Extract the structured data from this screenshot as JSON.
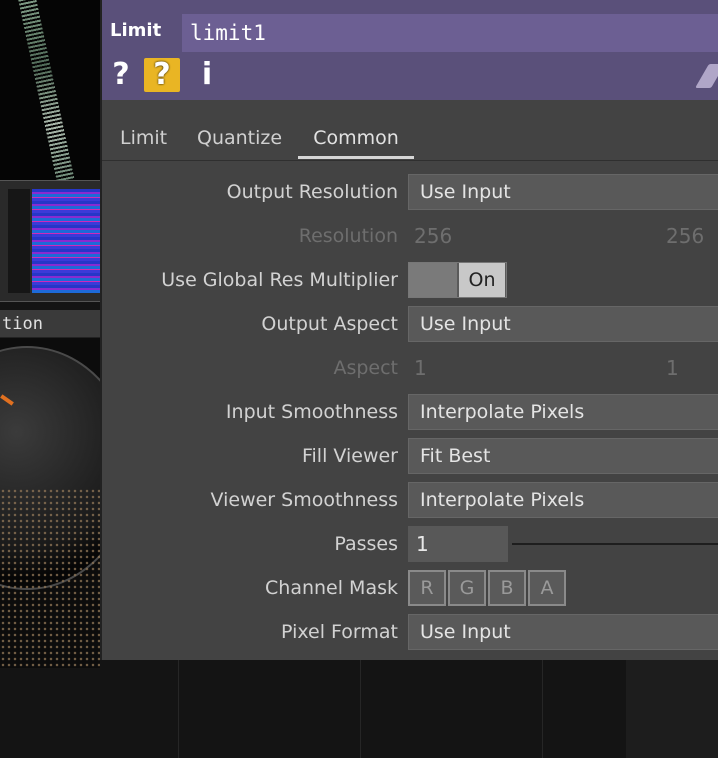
{
  "network": {
    "node_label": "tion"
  },
  "panel": {
    "op_type": "Limit",
    "op_name": "limit1",
    "icons": [
      "help-icon",
      "python-help-icon",
      "info-icon",
      "pencil-icon"
    ],
    "help_glyph": "?",
    "info_glyph": "i",
    "tabs": [
      {
        "label": "Limit",
        "active": false
      },
      {
        "label": "Quantize",
        "active": false
      },
      {
        "label": "Common",
        "active": true
      }
    ],
    "params": {
      "output_resolution": {
        "label": "Output Resolution",
        "value": "Use Input"
      },
      "resolution": {
        "label": "Resolution",
        "w": "256",
        "h": "256"
      },
      "global_res": {
        "label": "Use Global Res Multiplier",
        "value": "On"
      },
      "output_aspect": {
        "label": "Output Aspect",
        "value": "Use Input"
      },
      "aspect": {
        "label": "Aspect",
        "a1": "1",
        "a2": "1"
      },
      "input_smoothness": {
        "label": "Input Smoothness",
        "value": "Interpolate Pixels"
      },
      "fill_viewer": {
        "label": "Fill Viewer",
        "value": "Fit Best"
      },
      "viewer_smoothness": {
        "label": "Viewer Smoothness",
        "value": "Interpolate Pixels"
      },
      "passes": {
        "label": "Passes",
        "value": "1"
      },
      "channel_mask": {
        "label": "Channel Mask",
        "channels": [
          "R",
          "G",
          "B",
          "A"
        ]
      },
      "pixel_format": {
        "label": "Pixel Format",
        "value": "Use Input"
      }
    }
  },
  "colors": {
    "header": "#5a507a",
    "name_field": "#6c5f93",
    "panel_bg": "#434343",
    "help_highlight": "#e9b524"
  }
}
